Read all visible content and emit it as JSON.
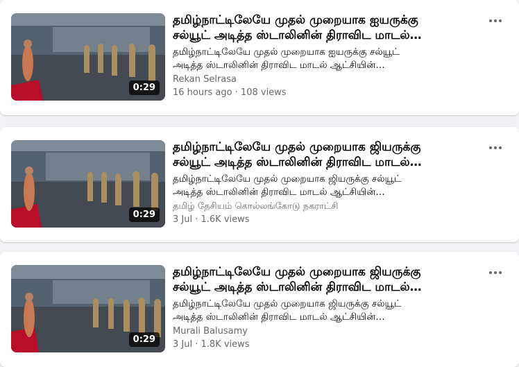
{
  "videos": [
    {
      "title_line1": "தமிழ்நாட்டிலேயே முதல் முறையாக ஐயருக்கு",
      "title_line2": "சல்யூட் அடித்த ஸ்டாலினின் திராவிட மாடல்…",
      "desc_line1": "தமிழ்நாட்டிலேயே முதல் முறையாக ஐயருக்கு சல்யூட்",
      "desc_line2": "அடித்த ஸ்டாலினின் திராவிட மாடல் ஆட்சியின்…",
      "author": "Rekan Selrasa",
      "meta": "16 hours ago · 108 views",
      "duration": "0:29"
    },
    {
      "title_line1": "தமிழ்நாட்டிலேயே முதல் முறையாக ஜியருக்கு",
      "title_line2": "சல்யூட் அடித்த ஸ்டாலினின் திராவிட மாடல்…",
      "desc_line1": "தமிழ்நாட்டிலேயே முதல் முறையாக ஜியருக்கு சல்யூட்",
      "desc_line2": "அடித்த ஸ்டாலினின் திராவிட மாடல் ஆட்சியின்…",
      "author": "தமிழ் தேசியம் கொல்லங்கோடு நகராட்சி",
      "meta": "3 Jul · 1.6K views",
      "duration": "0:29"
    },
    {
      "title_line1": "தமிழ்நாட்டிலேயே முதல் முறையாக ஜியருக்கு",
      "title_line2": "சல்யூட் அடித்த ஸ்டாலினின் திராவிட மாடல்…",
      "desc_line1": "தமிழ்நாட்டிலேயே முதல் முறையாக ஜியருக்கு சல்யூட்",
      "desc_line2": "அடித்த ஸ்டாலினின் திராவிட மாடல் ஆட்சியின்…",
      "author": "Murali Balusamy",
      "meta": "3 Jul · 1.8K views",
      "duration": "0:29"
    }
  ],
  "icons": {
    "menu": "more-horizontal-icon"
  },
  "colors": {
    "background": "#f0f2f5",
    "card": "#ffffff",
    "muted_text": "#65676b",
    "carpet": "#c8102e"
  }
}
